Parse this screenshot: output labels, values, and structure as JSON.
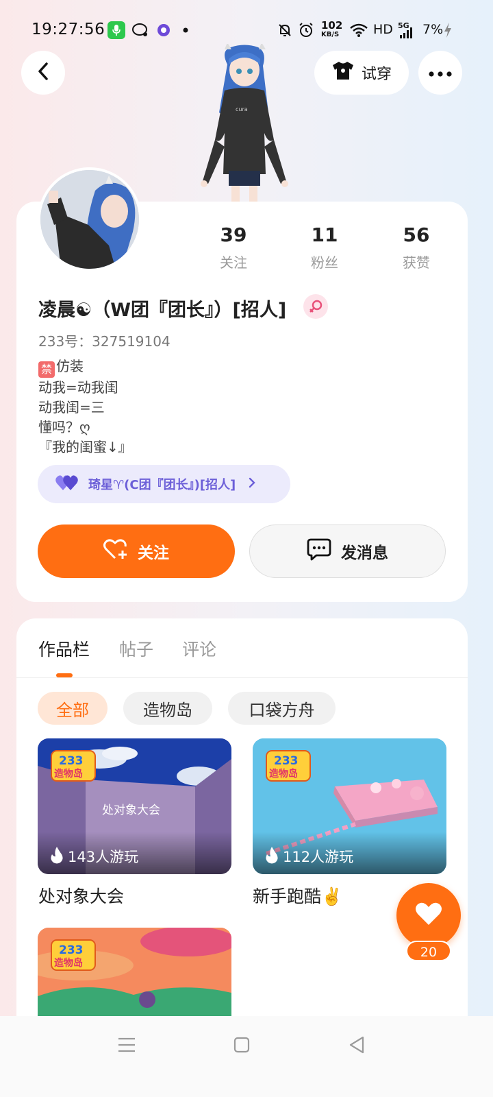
{
  "status_bar": {
    "time": "19:27:56",
    "net_speed_value": "102",
    "net_speed_unit": "KB/S",
    "hd_label": "HD",
    "signal_label": "5G",
    "battery_text": "7%",
    "icons": [
      "mic-icon",
      "chat-bubble-icon",
      "vpn-icon",
      "dot-icon",
      "mute-bell-icon",
      "alarm-icon",
      "wifi-icon",
      "signal-icon",
      "charging-icon"
    ]
  },
  "header": {
    "back_icon": "chevron-left-icon",
    "tryon_label": "试穿",
    "tryon_icon": "tshirt-icon",
    "more_icon": "more-dots-icon"
  },
  "profile": {
    "stats": [
      {
        "value": "39",
        "label": "关注"
      },
      {
        "value": "11",
        "label": "粉丝"
      },
      {
        "value": "56",
        "label": "获赞"
      }
    ],
    "nickname": "凌晨☯（W团『团长』）[招人]",
    "gender": "female",
    "user_id": "233号：327519104",
    "bio_badge": "禁",
    "bio_lines": [
      "仿装",
      "动我=动我闺",
      "动我闺=三",
      "懂吗？ღ",
      "『我的闺蜜↓』"
    ],
    "bestie_name": "琦星♈(C团『团长』)[招人]",
    "follow_label": "关注",
    "message_label": "发消息"
  },
  "works": {
    "tabs": [
      {
        "label": "作品栏",
        "active": true
      },
      {
        "label": "帖子",
        "active": false
      },
      {
        "label": "评论",
        "active": false
      }
    ],
    "filters": [
      {
        "label": "全部",
        "active": true
      },
      {
        "label": "造物岛",
        "active": false
      },
      {
        "label": "口袋方舟",
        "active": false
      }
    ],
    "logo_text": {
      "top": "233",
      "bottom": "造物岛"
    },
    "games": [
      {
        "title": "处对象大会",
        "plays": "143人游玩",
        "scene_text": "处对象大会"
      },
      {
        "title": "新手跑酷✌️",
        "plays": "112人游玩"
      },
      {
        "title": "",
        "plays": ""
      }
    ]
  },
  "like_fab": {
    "count": "20"
  },
  "colors": {
    "accent": "#ff6e12",
    "bestie": "#6c5fd8",
    "female": "#e8527a"
  }
}
